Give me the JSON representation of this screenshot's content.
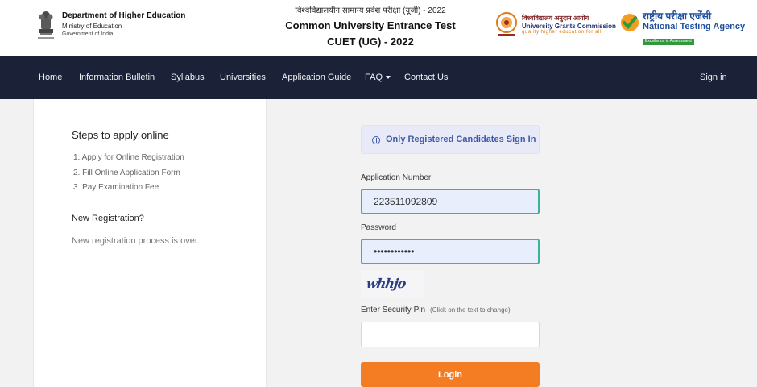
{
  "header": {
    "department": "Department of Higher Education",
    "ministry": "Ministry of Education",
    "government": "Government of India",
    "hindi_title": "विश्वविद्यालयीन सामान्य प्रवेश परीक्षा (यूजी) - 2022",
    "title_line1": "Common University Entrance Test",
    "title_line2": "CUET (UG) - 2022",
    "ugc_hindi": "विश्वविद्यालय अनुदान आयोग",
    "ugc_name": "University Grants Commission",
    "ugc_tagline": "quality higher education for all",
    "nta_hindi": "राष्ट्रीय परीक्षा एजेंसी",
    "nta_name": "National Testing Agency",
    "nta_tagline": "Excellence in Assessment"
  },
  "nav": {
    "items": [
      "Home",
      "Information Bulletin",
      "Syllabus",
      "Universities",
      "Application Guide",
      "FAQ",
      "Contact Us"
    ],
    "signin": "Sign in"
  },
  "steps": {
    "title": "Steps to apply online",
    "items": [
      "1. Apply for Online Registration",
      "2. Fill Online Application Form",
      "3. Pay Examination Fee"
    ]
  },
  "new_registration": {
    "title": "New Registration?",
    "text": "New registration process is over."
  },
  "login": {
    "notice": "Only Registered Candidates Sign In",
    "app_number_label": "Application Number",
    "app_number_value": "223511092809",
    "password_label": "Password",
    "password_value": "••••••••••••",
    "captcha_text": "whhjo",
    "security_pin_label": "Enter Security Pin",
    "security_pin_hint": "(Click on the text to change)",
    "security_pin_value": "",
    "button": "Login"
  },
  "colors": {
    "navbar": "#1b2136",
    "accent_orange": "#f47c23",
    "notice_text": "#3f59a8",
    "field_border": "#3db39c",
    "nta_green": "#2f9a3b"
  },
  "icons": [
    "national-emblem-icon",
    "ugc-emblem-icon",
    "nta-checkmark-icon",
    "info-circle-icon",
    "caret-down-icon"
  ]
}
